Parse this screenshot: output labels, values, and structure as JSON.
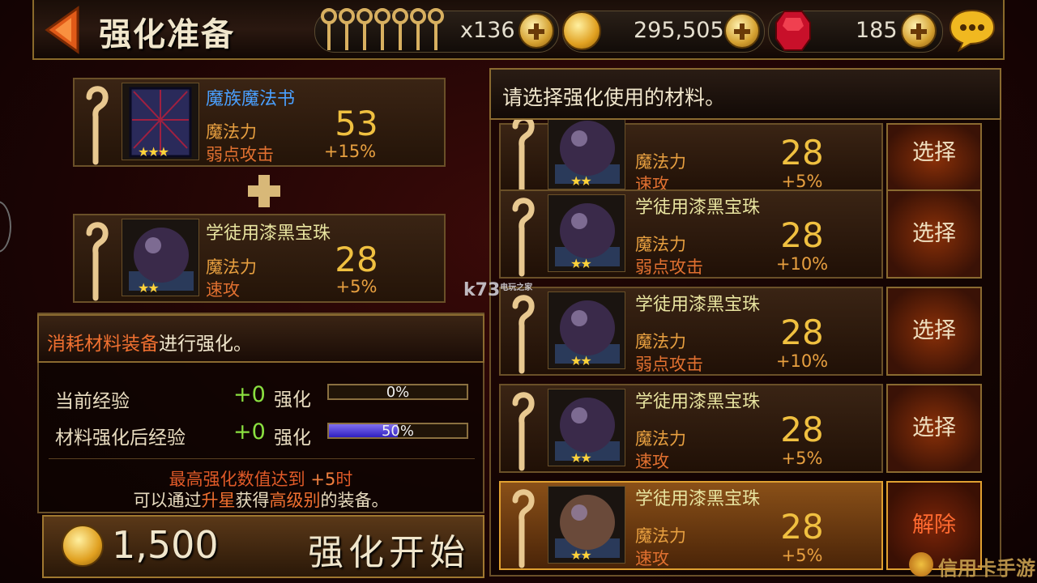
{
  "header": {
    "title": "强化准备",
    "keys": "x136",
    "gold": "295,505",
    "gems": "185"
  },
  "upgrade_target": {
    "item": {
      "name": "魔族魔法书",
      "stat_label": "魔法力",
      "stat_value": "53",
      "sub_label": "弱点攻击",
      "sub_value": "+15%",
      "stars": "★★★"
    },
    "material": {
      "name": "学徒用漆黑宝珠",
      "stat_label": "魔法力",
      "stat_value": "28",
      "sub_label": "速攻",
      "sub_value": "+5%",
      "stars": "★★"
    }
  },
  "info": {
    "heading_highlight": "消耗材料装备",
    "heading_rest": "进行强化。",
    "current_exp_label": "当前经验",
    "current_exp_value": "+0",
    "current_exp_unit": "强化",
    "current_exp_bar": "0%",
    "current_exp_fill": 0,
    "after_exp_label": "材料强化后经验",
    "after_exp_value": "+0",
    "after_exp_unit": "强化",
    "after_exp_bar": "50%",
    "after_exp_fill": 0.5,
    "note1_a": "最高强化数值达到 ",
    "note1_b": "+5",
    "note1_c": "时",
    "note2_a": "可以通过",
    "note2_b": "升星",
    "note2_c": "获得",
    "note2_d": "高级别",
    "note2_e": "的装备。"
  },
  "start": {
    "cost": "1,500",
    "label": "强化开始"
  },
  "material_list": {
    "heading": "请选择强化使用的材料。",
    "rows": [
      {
        "name": "",
        "stat_label": "魔法力",
        "stat_value": "28",
        "sub_label": "速攻",
        "sub_value": "+5%",
        "stars": "★★",
        "button": "选择"
      },
      {
        "name": "学徒用漆黑宝珠",
        "stat_label": "魔法力",
        "stat_value": "28",
        "sub_label": "弱点攻击",
        "sub_value": "+10%",
        "stars": "★★",
        "button": "选择"
      },
      {
        "name": "学徒用漆黑宝珠",
        "stat_label": "魔法力",
        "stat_value": "28",
        "sub_label": "弱点攻击",
        "sub_value": "+10%",
        "stars": "★★",
        "button": "选择"
      },
      {
        "name": "学徒用漆黑宝珠",
        "stat_label": "魔法力",
        "stat_value": "28",
        "sub_label": "速攻",
        "sub_value": "+5%",
        "stars": "★★",
        "button": "选择"
      },
      {
        "name": "学徒用漆黑宝珠",
        "stat_label": "魔法力",
        "stat_value": "28",
        "sub_label": "速攻",
        "sub_value": "+5%",
        "stars": "★★",
        "button": "解除"
      }
    ]
  },
  "watermark": {
    "site": "k73",
    "site_sub": "电玩之家",
    "corner": "信用卡手游"
  }
}
